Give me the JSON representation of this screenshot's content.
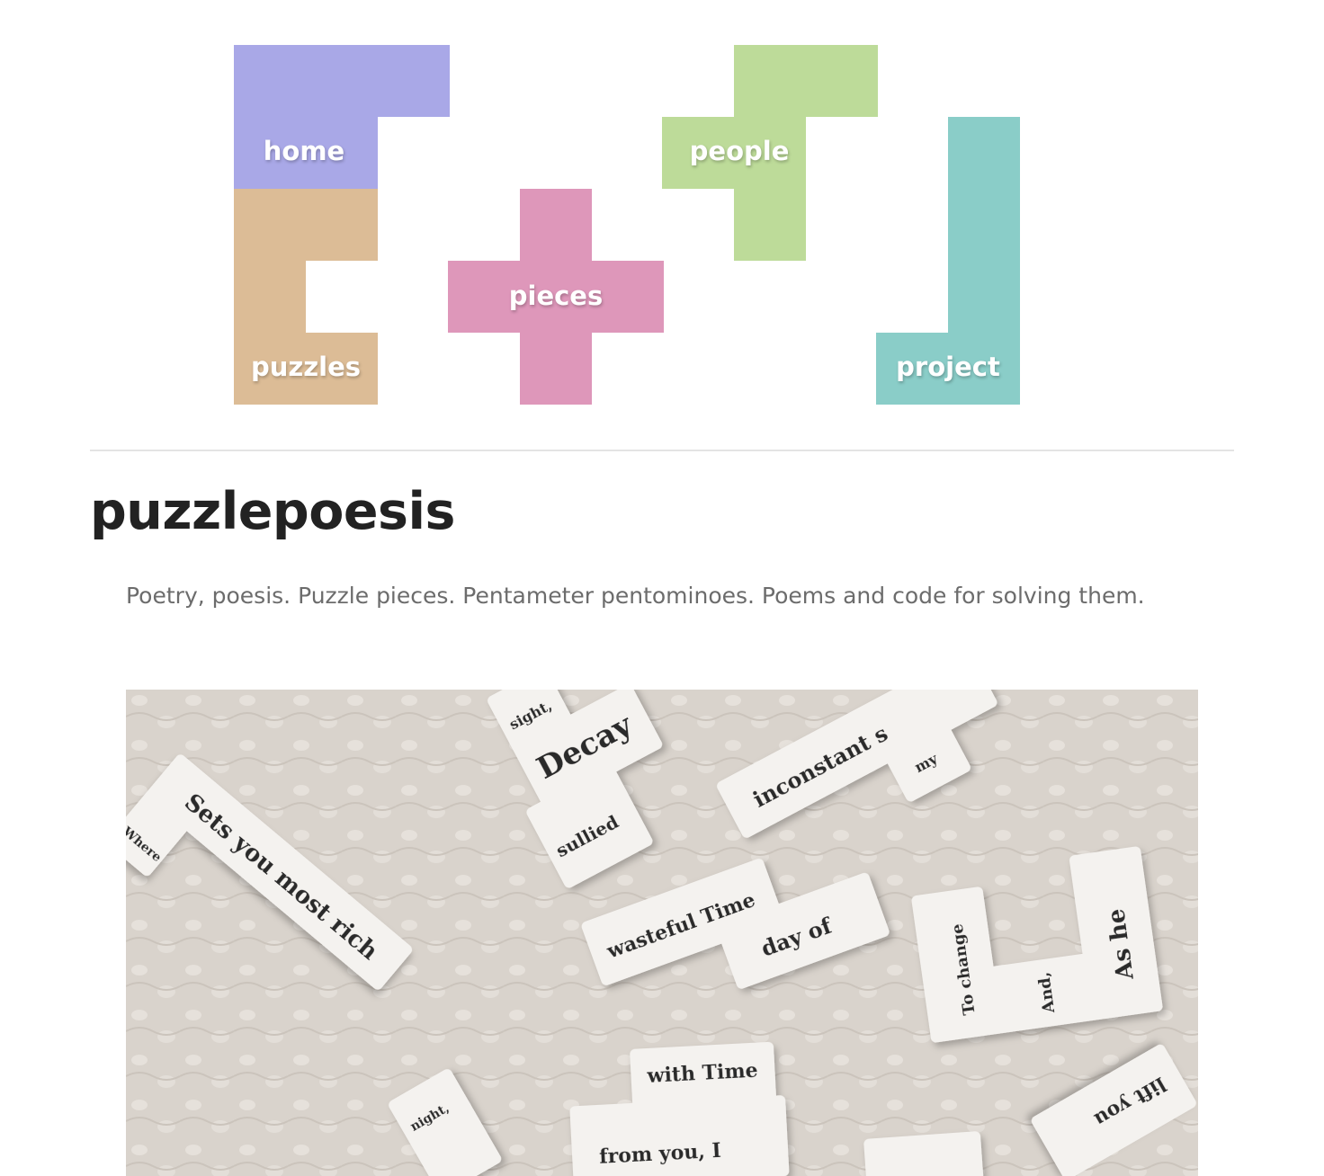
{
  "nav": {
    "items": [
      {
        "label": "home",
        "color": "#a9a8e7"
      },
      {
        "label": "puzzles",
        "color": "#dcbc96"
      },
      {
        "label": "pieces",
        "color": "#de97ba"
      },
      {
        "label": "people",
        "color": "#bddb99"
      },
      {
        "label": "project",
        "color": "#8acdc8"
      }
    ]
  },
  "site": {
    "title": "puzzlepoesis",
    "tagline": "Poetry, poesis. Puzzle pieces. Pentameter pentominoes. Poems and code for solving them."
  },
  "photo": {
    "tiles": [
      {
        "text": "Sets you most rich"
      },
      {
        "text": "Where"
      },
      {
        "text": "sight,"
      },
      {
        "text": "Decay"
      },
      {
        "text": "sullied"
      },
      {
        "text": "inconstant s"
      },
      {
        "text": "my"
      },
      {
        "text": "wasteful Time"
      },
      {
        "text": "day of"
      },
      {
        "text": "To change"
      },
      {
        "text": "And,"
      },
      {
        "text": "As he"
      },
      {
        "text": "with Time"
      },
      {
        "text": "from you, I"
      },
      {
        "text": "night,"
      },
      {
        "text": "lift you"
      }
    ]
  }
}
